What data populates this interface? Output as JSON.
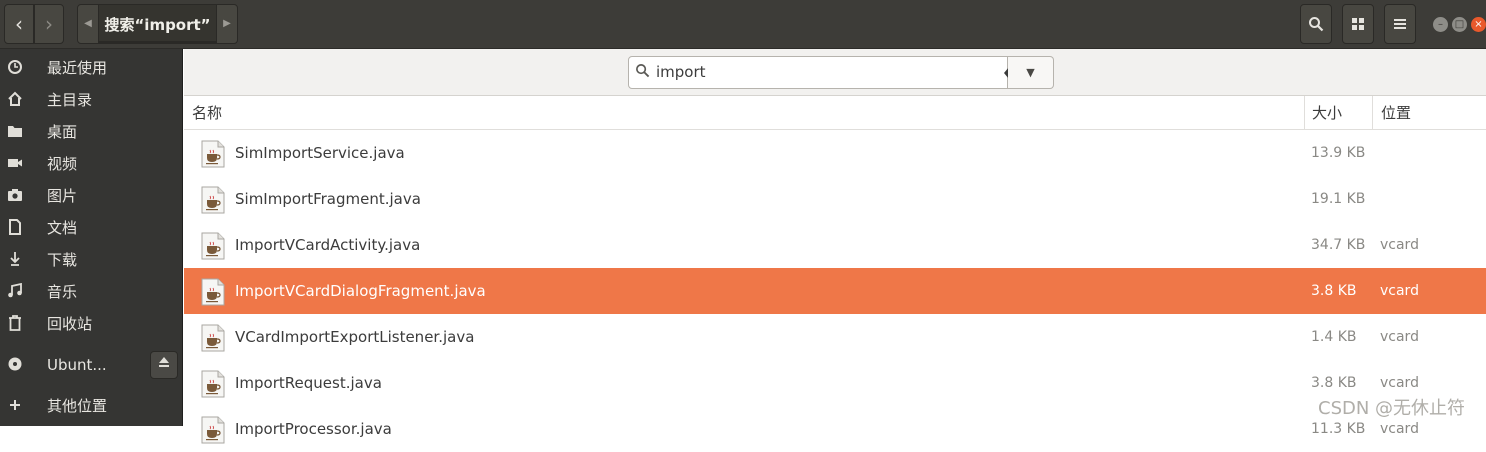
{
  "header": {
    "back_icon": "chevron-left-icon",
    "forward_icon": "chevron-right-icon",
    "breadcrumb": "搜索“import”",
    "search_icon": "search-icon",
    "view_icon": "grid-view-icon",
    "menu_icon": "hamburger-menu-icon"
  },
  "sidebar": {
    "items": [
      {
        "label": "最近使用",
        "icon": "clock-icon"
      },
      {
        "label": "主目录",
        "icon": "home-icon"
      },
      {
        "label": "桌面",
        "icon": "folder-icon"
      },
      {
        "label": "视频",
        "icon": "video-icon"
      },
      {
        "label": "图片",
        "icon": "camera-icon"
      },
      {
        "label": "文档",
        "icon": "document-icon"
      },
      {
        "label": "下载",
        "icon": "download-icon"
      },
      {
        "label": "音乐",
        "icon": "music-icon"
      },
      {
        "label": "回收站",
        "icon": "trash-icon"
      },
      {
        "label": "Ubunt...",
        "icon": "disc-icon"
      },
      {
        "label": "其他位置",
        "icon": "plus-icon"
      }
    ],
    "eject_icon": "eject-icon"
  },
  "search": {
    "value": "import"
  },
  "columns": {
    "name": "名称",
    "size": "大小",
    "location": "位置"
  },
  "files": [
    {
      "name": "SimImportService.java",
      "size": "13.9 KB",
      "location": ""
    },
    {
      "name": "SimImportFragment.java",
      "size": "19.1 KB",
      "location": ""
    },
    {
      "name": "ImportVCardActivity.java",
      "size": "34.7 KB",
      "location": "vcard"
    },
    {
      "name": "ImportVCardDialogFragment.java",
      "size": "3.8 KB",
      "location": "vcard",
      "selected": true
    },
    {
      "name": "VCardImportExportListener.java",
      "size": "1.4 KB",
      "location": "vcard"
    },
    {
      "name": "ImportRequest.java",
      "size": "3.8 KB",
      "location": "vcard"
    },
    {
      "name": "ImportProcessor.java",
      "size": "11.3 KB",
      "location": "vcard"
    }
  ],
  "colors": {
    "selection": "#ef7748",
    "header": "#3d3c38",
    "sidebar": "#353533"
  },
  "watermark": "CSDN @无休止符"
}
